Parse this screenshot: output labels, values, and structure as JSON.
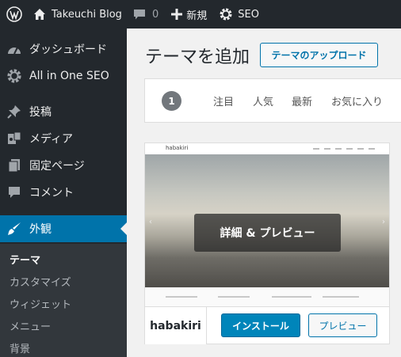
{
  "admin_bar": {
    "site_name": "Takeuchi Blog",
    "comments_count": "0",
    "new_label": "新規",
    "seo_label": "SEO"
  },
  "sidebar": {
    "items": [
      {
        "label": "ダッシュボード",
        "icon": "dashboard-icon"
      },
      {
        "label": "All in One SEO",
        "icon": "gear-icon"
      },
      {
        "label": "投稿",
        "icon": "pin-icon"
      },
      {
        "label": "メディア",
        "icon": "media-icon"
      },
      {
        "label": "固定ページ",
        "icon": "page-icon"
      },
      {
        "label": "コメント",
        "icon": "comment-icon"
      },
      {
        "label": "外観",
        "icon": "brush-icon"
      }
    ],
    "submenu": [
      {
        "label": "テーマ"
      },
      {
        "label": "カスタマイズ"
      },
      {
        "label": "ウィジェット"
      },
      {
        "label": "メニュー"
      },
      {
        "label": "背景"
      }
    ]
  },
  "main": {
    "title": "テーマを追加",
    "upload_label": "テーマのアップロード",
    "filter": {
      "count": "1",
      "tabs": [
        "注目",
        "人気",
        "最新",
        "お気に入り"
      ]
    },
    "theme": {
      "name": "habakiri",
      "screenshot_logo": "habakiri",
      "details_label": "詳細 & プレビュー",
      "install_label": "インストール",
      "preview_label": "プレビュー"
    }
  },
  "colors": {
    "admin_bg": "#23282d",
    "accent": "#0073aa",
    "primary_button": "#0085ba"
  }
}
